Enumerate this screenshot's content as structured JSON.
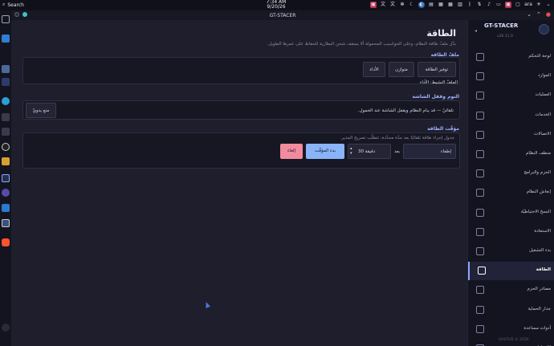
{
  "panel": {
    "search": "Search",
    "time": "7:34 AM",
    "date": "9/20/26",
    "lang": "ara"
  },
  "window": {
    "title": "GT-STACER"
  },
  "page": {
    "title": "الطاقة",
    "subtitle": "بدّل ملفّ طاقة النظام، وعلى الحواسيب المحمولة ألا يسقف شحن البطارية للحفاظ على عمرها الطويل."
  },
  "profile": {
    "section": "ملفّ الطاقة",
    "saver": "توفير الطاقة",
    "balanced": "متوازن",
    "performance": "الأداء",
    "active": "الملفّ النشيط: الأداء"
  },
  "sleep": {
    "section": "النوم وقفل الشاشة",
    "desc": "تلقائيّ — قد ينام النظام ويقفل الشاشة عند الخمول.",
    "inhibit": "منع يدويّ"
  },
  "timer": {
    "section": "مؤقّت الطاقة",
    "desc": "جدول إجراء طاقة تلقائيًا بعد مدّة محدّدة، تتطلّب تصريح المدير.",
    "action": "إطفاء",
    "after": "بعد",
    "duration": "30 دقيقة",
    "start": "بدء المؤقّت",
    "cancel": "إلغاء"
  },
  "sidebar": {
    "brand": "GT-STACER",
    "version": "v26.11.0",
    "footer": "GAUTUS © 2026",
    "items": [
      {
        "label": "لوحة التحكم"
      },
      {
        "label": "الموارد"
      },
      {
        "label": "العمليات"
      },
      {
        "label": "الخدمات"
      },
      {
        "label": "الاتصالات"
      },
      {
        "label": "منظف النظام"
      },
      {
        "label": "الحزم والبرامج"
      },
      {
        "label": "إنعاش النظام"
      },
      {
        "label": "النسخ الاحتياطيّة"
      },
      {
        "label": "الاستعادة"
      },
      {
        "label": "بدء التشغيل"
      },
      {
        "label": "الطاقة"
      },
      {
        "label": "مصادر الحزم"
      },
      {
        "label": "جدار الحماية"
      },
      {
        "label": "أدوات مساعدة"
      },
      {
        "label": "الإعدادات"
      }
    ]
  },
  "colors": {
    "accent": "#8fa6ff",
    "start_btn": "#8ab4f8",
    "cancel_btn": "#f28b9e"
  }
}
